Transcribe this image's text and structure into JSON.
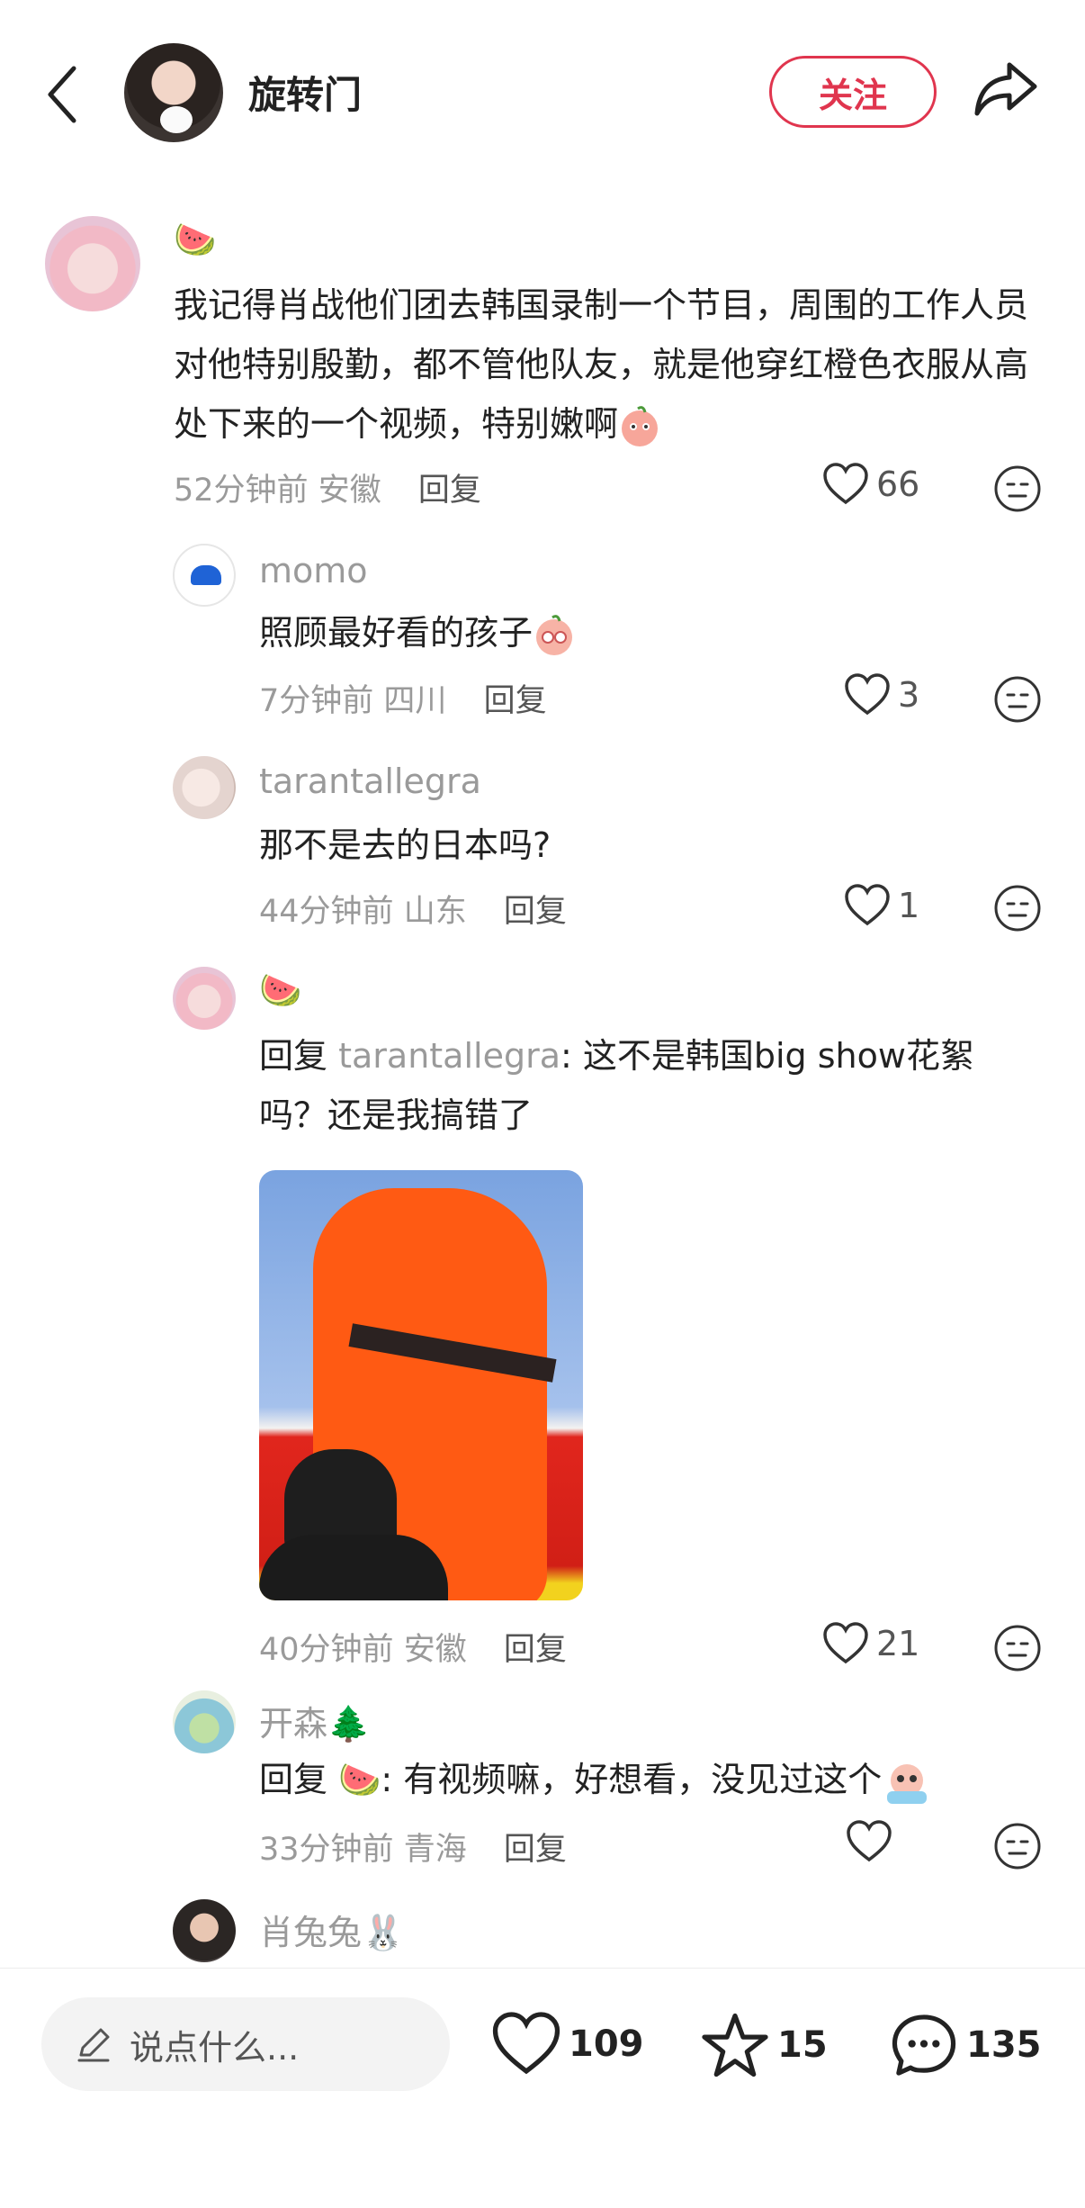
{
  "header": {
    "title": "旋转门",
    "follow_label": "关注"
  },
  "comments": [
    {
      "username_emoji": "🍉",
      "text": "我记得肖战他们团去韩国录制一个节目，周围的工作人员对他特别殷勤，都不管他队友，就是他穿红橙色衣服从高处下来的一个视频，特别嫩啊",
      "time": "52分钟前",
      "location": "安徽",
      "reply_label": "回复",
      "likes": "66"
    }
  ],
  "replies": [
    {
      "username": "momo",
      "text": "照顾最好看的孩子",
      "time": "7分钟前",
      "location": "四川",
      "reply_label": "回复",
      "likes": "3"
    },
    {
      "username": "tarantallegra",
      "text": "那不是去的日本吗?",
      "time": "44分钟前",
      "location": "山东",
      "reply_label": "回复",
      "likes": "1"
    },
    {
      "username_emoji": "🍉",
      "reply_prefix": "回复 ",
      "mention": "tarantallegra",
      "text_line1": ": 这不是韩国big show花絮",
      "text_line2": "吗？还是我搞错了",
      "time": "40分钟前",
      "location": "安徽",
      "reply_label": "回复",
      "likes": "21"
    },
    {
      "username": "开森",
      "username_emoji": "🌲",
      "reply_prefix": "回复 ",
      "mention_emoji": "🍉",
      "text": ": 有视频嘛，好想看，没见过这个",
      "time": "33分钟前",
      "location": "青海",
      "reply_label": "回复",
      "likes": ""
    },
    {
      "username": "肖兔兔",
      "username_emoji": "🐰"
    }
  ],
  "bottom_bar": {
    "input_placeholder": "说点什么...",
    "likes": "109",
    "stars": "15",
    "comments": "135"
  },
  "colors": {
    "accent": "#e0354e",
    "meta_gray": "#9a9a9a"
  }
}
